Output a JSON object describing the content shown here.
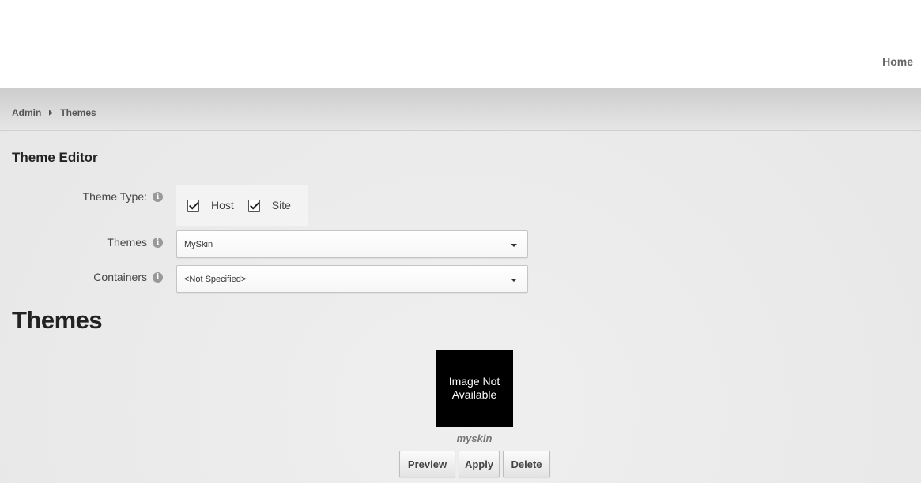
{
  "header": {
    "nav_home": "Home"
  },
  "breadcrumb": {
    "items": [
      "Admin",
      "Themes"
    ]
  },
  "editor": {
    "title": "Theme Editor",
    "theme_type_label": "Theme Type:",
    "checkboxes": [
      {
        "label": "Host",
        "checked": true
      },
      {
        "label": "Site",
        "checked": true
      }
    ],
    "themes_label": "Themes",
    "themes_selected": "MySkin",
    "containers_label": "Containers",
    "containers_selected": "<Not Specified>"
  },
  "themes_section": {
    "heading": "Themes",
    "thumbnail_text": "Image Not Available",
    "skin_name": "myskin",
    "buttons": {
      "preview": "Preview",
      "apply": "Apply",
      "delete": "Delete"
    }
  },
  "icons": {
    "info": "info-icon",
    "dropdown": "chevron-down-icon",
    "check": "checkmark-icon",
    "separator": "chevron-right-icon"
  }
}
